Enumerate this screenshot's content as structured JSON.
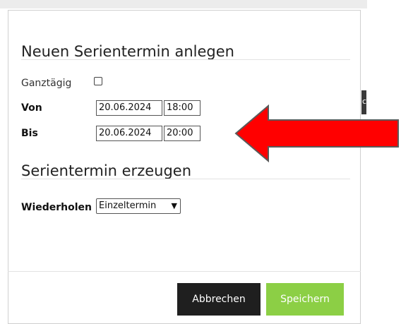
{
  "dialog": {
    "title": "Neuen Serientermin anlegen",
    "ganztag_label": "Ganztägig",
    "ganztag_checked": false,
    "von_label": "Von",
    "von_date": "20.06.2024",
    "von_time": "18:00",
    "bis_label": "Bis",
    "bis_date": "20.06.2024",
    "bis_time": "20:00",
    "section_title": "Serientermin erzeugen",
    "wiederholen_label": "Wiederholen",
    "wiederholen_value": "Einzeltermin",
    "cancel_label": "Abbrechen",
    "save_label": "Speichern"
  },
  "background": {
    "tab_text": "c"
  },
  "colors": {
    "save_button": "#8ccf45",
    "cancel_button": "#1f1f1f",
    "arrow": "#ff0000"
  },
  "icons": {
    "dropdown": "chevron-down-icon",
    "annotation": "left-arrow-icon"
  }
}
